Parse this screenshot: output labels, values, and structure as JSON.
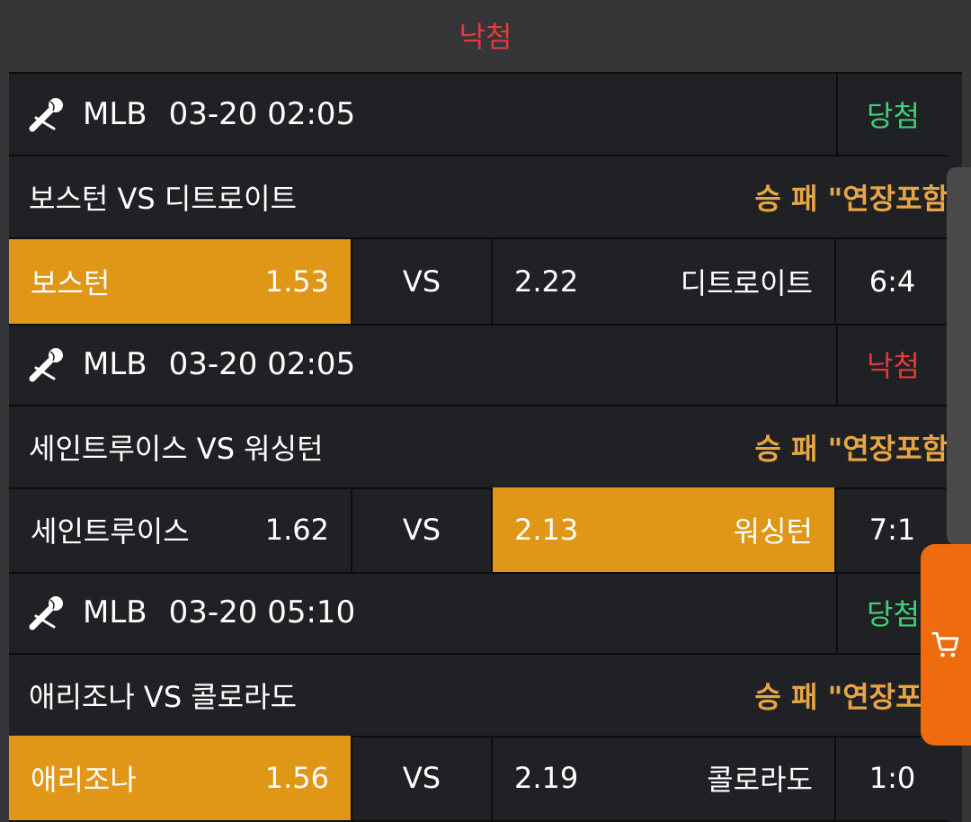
{
  "header": {
    "status": "낙첨"
  },
  "matches": [
    {
      "league": "MLB",
      "datetime": "03-20 02:05",
      "result": "당첨",
      "title": "보스턴 VS 디트로이트",
      "market": "승 패 \"연장포함",
      "home": {
        "name": "보스턴",
        "odds": "1.53"
      },
      "vs": "VS",
      "away": {
        "odds": "2.22",
        "name": "디트로이트"
      },
      "score": "6:4"
    },
    {
      "league": "MLB",
      "datetime": "03-20 02:05",
      "result": "낙첨",
      "title": "세인트루이스 VS 워싱턴",
      "market": "승 패 \"연장포함",
      "home": {
        "name": "세인트루이스",
        "odds": "1.62"
      },
      "vs": "VS",
      "away": {
        "odds": "2.13",
        "name": "워싱턴"
      },
      "score": "7:1"
    },
    {
      "league": "MLB",
      "datetime": "03-20 05:10",
      "result": "당첨",
      "title": "애리조나 VS 콜로라도",
      "market": "승 패 \"연장포함",
      "home": {
        "name": "애리조나",
        "odds": "1.56"
      },
      "vs": "VS",
      "away": {
        "odds": "2.19",
        "name": "콜로라도"
      },
      "score": "1:0"
    }
  ],
  "colors": {
    "win": "#3fd07a",
    "lose": "#e23b3b",
    "selected": "#e09617",
    "market": "#e7a545",
    "cart": "#ee6b0e"
  },
  "icons": {
    "league": "baseball-icon",
    "cart": "cart-icon"
  }
}
